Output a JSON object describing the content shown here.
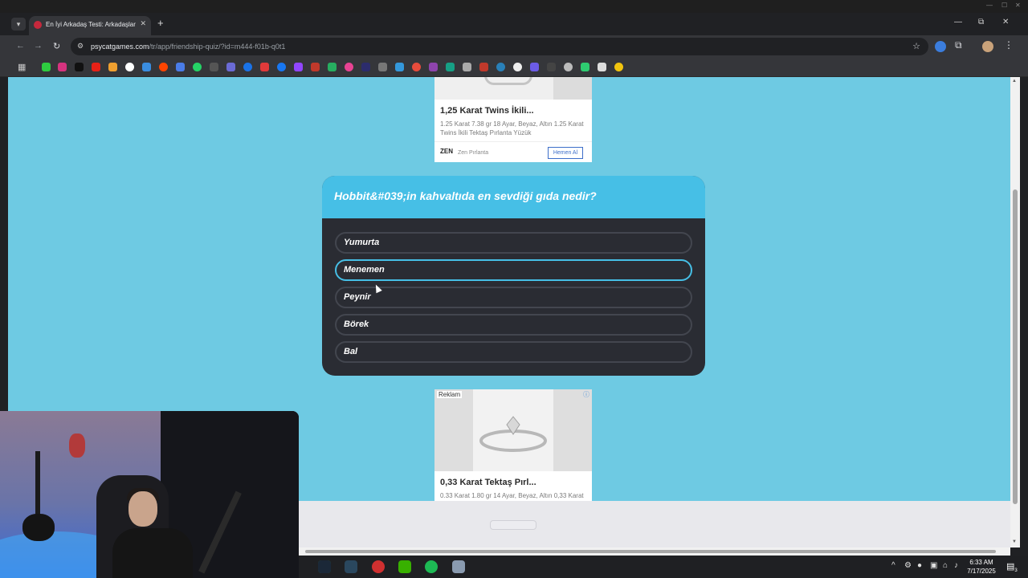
{
  "browser": {
    "tab_title": "En İyi Arkadaş Testi: Arkadaşların",
    "tab_list_icon": "chevron-down-icon",
    "new_tab": "+",
    "tab_close": "✕",
    "url_host": "psycatgames.com",
    "url_path": "/tr/app/friendship-quiz/?id=m444-f01b-q0t1",
    "window_controls": {
      "minimize": "—",
      "maximize": "⧉",
      "close": "✕"
    }
  },
  "page": {
    "ad_top": {
      "title": "1,25 Karat Twins İkili...",
      "description": "1.25 Karat 7.38 gr 18 Ayar, Beyaz, Altın 1.25 Karat Twins İkili Tektaş Pırlanta Yüzük",
      "brand_logo": "ZEN",
      "brand": "Zen Pırlanta",
      "cta": "Hemen Al"
    },
    "quiz": {
      "question": "Hobbit&#039;in kahvaltıda en sevdiği gıda nedir?",
      "options": [
        "Yumurta",
        "Menemen",
        "Peynir",
        "Börek",
        "Bal"
      ],
      "selected_index": 1
    },
    "ad_bottom": {
      "label": "Reklam",
      "title": "0,33 Karat Tektaş Pırl...",
      "description": "0.33 Karat 1.80 gr 14 Ayar, Beyaz, Altın 0,33 Karat"
    }
  },
  "taskbar": {
    "time": "6:33 AM",
    "date": "7/17/2025",
    "notification_count": "3"
  },
  "colors": {
    "page_bg": "#6ecae3",
    "quiz_header": "#46bfe6",
    "quiz_body": "#2a2c33",
    "selected_border": "#46bfe6"
  }
}
